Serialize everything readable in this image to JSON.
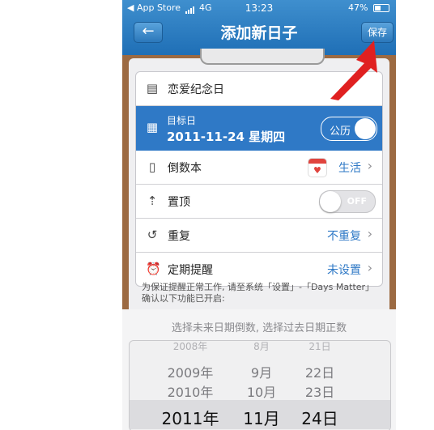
{
  "status_bar": {
    "back_app": "◀ App Store",
    "network": "4G",
    "time": "13:23",
    "battery": "47%"
  },
  "nav": {
    "back_icon": "←",
    "title": "添加新日子",
    "save_label": "保存"
  },
  "form": {
    "name": {
      "value": "恋爱纪念日"
    },
    "target_date": {
      "label": "目标日",
      "value": "2011-11-24 星期四",
      "toggle_label": "公历"
    },
    "book": {
      "label": "倒数本",
      "value": "生活"
    },
    "pin": {
      "label": "置顶",
      "toggle_label": "OFF"
    },
    "repeat": {
      "label": "重复",
      "value": "不重复"
    },
    "reminder": {
      "label": "定期提醒",
      "value": "未设置"
    },
    "note": "为保证提醒正常工作, 请至系统「设置」-「Days Matter」 确认以下功能已开启:"
  },
  "picker": {
    "hint": "选择未来日期倒数, 选择过去日期正数",
    "rows": [
      {
        "year": "2008年",
        "month": "8月",
        "day": "21日"
      },
      {
        "year": "2009年",
        "month": "9月",
        "day": "22日"
      },
      {
        "year": "2010年",
        "month": "10月",
        "day": "23日"
      },
      {
        "year": "2011年",
        "month": "11月",
        "day": "24日"
      }
    ]
  },
  "colors": {
    "accent": "#2f79c6",
    "nav_bg": "#1f6fb6",
    "annotation_arrow": "#e02020",
    "wood": "#9c6a42"
  }
}
